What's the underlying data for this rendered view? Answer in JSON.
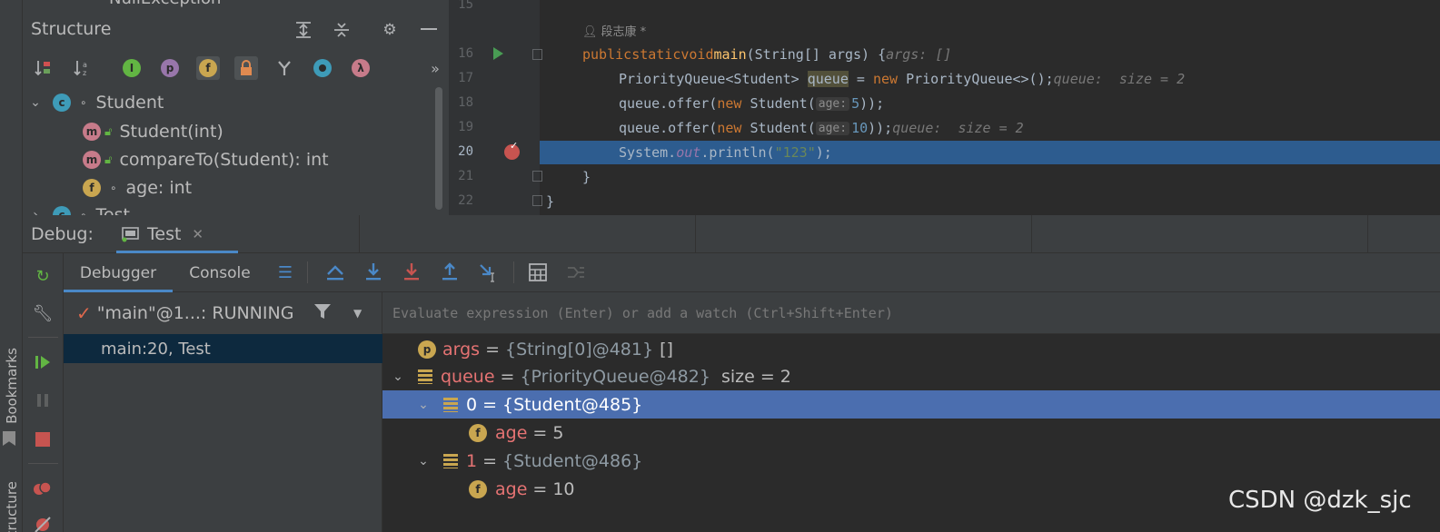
{
  "structure": {
    "top_item": "NullException",
    "title": "Structure",
    "tree": [
      {
        "label": "Student",
        "badge": "c"
      },
      {
        "label": "Student(int)",
        "badge": "m"
      },
      {
        "label": "compareTo(Student): int",
        "badge": "m"
      },
      {
        "label": "age: int",
        "badge": "f"
      },
      {
        "label": "Test",
        "badge": "c"
      }
    ]
  },
  "editor": {
    "author": "段志康 *",
    "lines": [
      {
        "num": "15"
      },
      {
        "num": "16"
      },
      {
        "num": "17"
      },
      {
        "num": "18"
      },
      {
        "num": "19"
      },
      {
        "num": "20"
      },
      {
        "num": "21"
      },
      {
        "num": "22"
      }
    ],
    "code": {
      "l16_public": "public",
      "l16_static": "static",
      "l16_void": "void",
      "l16_main": "main",
      "l16_params": "(String[] args) {",
      "l16_hint": "args: []",
      "l17_type": "PriorityQueue<Student> ",
      "l17_var": "queue",
      "l17_eq": " = ",
      "l17_new": "new",
      "l17_ctor": " PriorityQueue<>();",
      "l17_hint": "queue:  size = 2",
      "l18_call": "queue.offer(",
      "l18_new": "new",
      "l18_ctor": " Student(",
      "l18_inlay": "age:",
      "l18_num": "5",
      "l18_end": "));",
      "l19_call": "queue.offer(",
      "l19_new": "new",
      "l19_ctor": " Student(",
      "l19_inlay": "age:",
      "l19_num": "10",
      "l19_end": "));",
      "l19_hint": "queue:  size = 2",
      "l20_sys": "System.",
      "l20_out": "out",
      "l20_println": ".println(",
      "l20_str": "\"123\"",
      "l20_end": ");",
      "l21": "}",
      "l22": "}"
    }
  },
  "debug": {
    "title": "Debug:",
    "session_tab": "Test",
    "tabs": {
      "debugger": "Debugger",
      "console": "Console"
    },
    "thread": "\"main\"@1...: RUNNING",
    "frame": "main:20, Test",
    "eval_placeholder": "Evaluate expression (Enter) or add a watch (Ctrl+Shift+Enter)",
    "vars": [
      {
        "name": "args",
        "eq": "=",
        "type": "{String[0]@481}",
        "value": "[]"
      },
      {
        "name": "queue",
        "eq": "=",
        "type": "{PriorityQueue@482}",
        "value": "size = 2"
      },
      {
        "name": "0",
        "eq": "=",
        "type": "{Student@485}",
        "value": ""
      },
      {
        "name": "age",
        "eq": "=",
        "type": "",
        "value": "5"
      },
      {
        "name": "1",
        "eq": "=",
        "type": "{Student@486}",
        "value": ""
      },
      {
        "name": "age",
        "eq": "=",
        "type": "",
        "value": "10"
      }
    ]
  },
  "side": {
    "bookmarks": "Bookmarks",
    "structure": "Structure"
  },
  "watermark": "CSDN @dzk_sjc",
  "colors": {
    "accent": "#4a88c7",
    "exec_line": "#2d5c8f",
    "selected_var": "#4b6eaf",
    "frame_sel": "#0d293e"
  }
}
